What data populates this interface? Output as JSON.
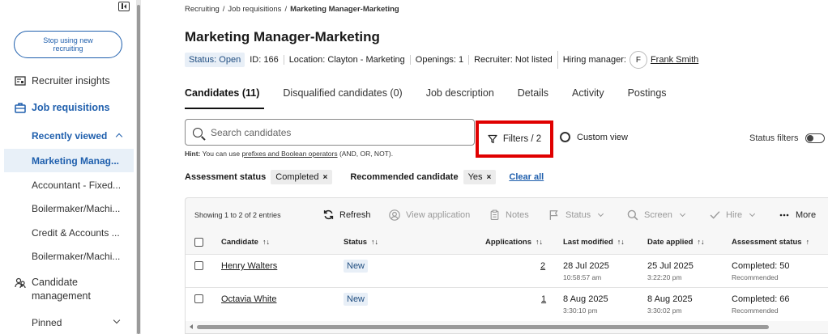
{
  "sidebar": {
    "stop_btn": "Stop using new recruiting",
    "recruiter_insights": "Recruiter insights",
    "job_requisitions": "Job requisitions",
    "recently_viewed": "Recently viewed",
    "recent_items": [
      "Marketing Manag...",
      "Accountant - Fixed...",
      "Boilermaker/Machi...",
      "Credit & Accounts ...",
      "Boilermaker/Machi..."
    ],
    "candidate_management": "Candidate management",
    "pinned": "Pinned"
  },
  "breadcrumb": {
    "items": [
      "Recruiting",
      "Job requisitions"
    ],
    "current": "Marketing Manager-Marketing",
    "sep": "/"
  },
  "page_title": "Marketing Manager-Marketing",
  "meta": {
    "status": "Status: Open",
    "id": "ID: 166",
    "location": "Location: Clayton - Marketing",
    "openings": "Openings: 1",
    "recruiter": "Recruiter: Not listed",
    "hiring_manager_label": "Hiring manager:",
    "avatar_initial": "F",
    "hiring_manager": "Frank Smith"
  },
  "tabs": [
    "Candidates (11)",
    "Disqualified candidates (0)",
    "Job description",
    "Details",
    "Activity",
    "Postings"
  ],
  "search": {
    "placeholder": "Search candidates"
  },
  "hint": {
    "label": "Hint:",
    "pre": "You can use",
    "link": "prefixes and Boolean operators",
    "post": "(AND, OR, NOT)."
  },
  "filters_label": "Filters / 2",
  "custom_view_label": "Custom view",
  "status_filters_label": "Status filters",
  "status_filters_on": false,
  "chips": {
    "assessment_label": "Assessment status",
    "assessment_value": "Completed",
    "recommended_label": "Recommended candidate",
    "recommended_value": "Yes",
    "remove": "×",
    "clear_all": "Clear all"
  },
  "toolbar": {
    "entries": "Showing 1 to 2 of 2 entries",
    "refresh": "Refresh",
    "view_application": "View application",
    "notes": "Notes",
    "status": "Status",
    "screen": "Screen",
    "hire": "Hire",
    "more": "More"
  },
  "table": {
    "headers": [
      "Candidate",
      "Status",
      "Applications",
      "Last modified",
      "Date applied",
      "Assessment status"
    ],
    "sort_icon": "↑↓",
    "sort_up": "↑",
    "rows": [
      {
        "name": "Henry Walters",
        "status": "New",
        "applications": "2",
        "modified": "28 Jul 2025",
        "modified_time": "10:58:57 am",
        "applied": "25 Jul 2025",
        "applied_time": "3:22:20 pm",
        "assessment": "Completed: 50",
        "assessment_sub": "Recommended"
      },
      {
        "name": "Octavia White",
        "status": "New",
        "applications": "1",
        "modified": "8 Aug 2025",
        "modified_time": "3:30:10 pm",
        "applied": "8 Aug 2025",
        "applied_time": "3:30:02 pm",
        "assessment": "Completed: 66",
        "assessment_sub": "Recommended"
      }
    ]
  },
  "colors": {
    "accent": "#1f5fad",
    "highlight": "#e00000",
    "badge_bg": "#e8eff7"
  }
}
